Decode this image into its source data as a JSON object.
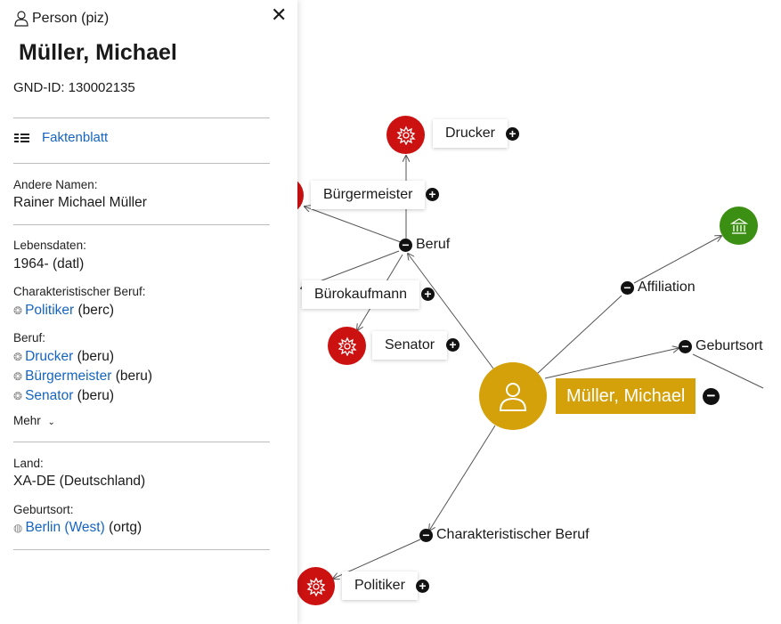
{
  "panel": {
    "entity_type": "Person (piz)",
    "close_symbol": "✕",
    "title": "Müller, Michael",
    "gnd_id": "GND-ID: 130002135",
    "faktenblatt": "Faktenblatt",
    "andere_namen_label": "Andere Namen:",
    "andere_namen_value": "Rainer Michael Müller",
    "lebensdaten_label": "Lebensdaten:",
    "lebensdaten_value": "1964- (datl)",
    "char_beruf_label": "Charakteristischer Beruf:",
    "char_beruf": [
      {
        "name": "Politiker",
        "code": " (berc)"
      }
    ],
    "beruf_label": "Beruf:",
    "beruf": [
      {
        "name": "Drucker",
        "code": " (beru)"
      },
      {
        "name": "Bürgermeister",
        "code": " (beru)"
      },
      {
        "name": "Senator",
        "code": " (beru)"
      }
    ],
    "mehr": "Mehr",
    "land_label": "Land:",
    "land_value": "XA-DE (Deutschland)",
    "geburtsort_label": "Geburtsort:",
    "geburtsort": {
      "name": "Berlin (West)",
      "code": " (ortg)"
    }
  },
  "graph": {
    "main_node": "Müller, Michael",
    "nodes": {
      "drucker": "Drucker",
      "buergermeister": "Bürgermeister",
      "buerokaufmann": "Bürokaufmann",
      "senator": "Senator",
      "politiker": "Politiker"
    },
    "edges": {
      "beruf": "Beruf",
      "affiliation": "Affiliation",
      "geburtsort": "Geburtsort",
      "char_beruf": "Charakteristischer Beruf"
    },
    "plus_symbol": "+",
    "minus_symbol": "−"
  },
  "colors": {
    "occupation": "#cc1111",
    "person": "#d4a10a",
    "organisation": "#3b8f12",
    "link": "#1565c0"
  }
}
